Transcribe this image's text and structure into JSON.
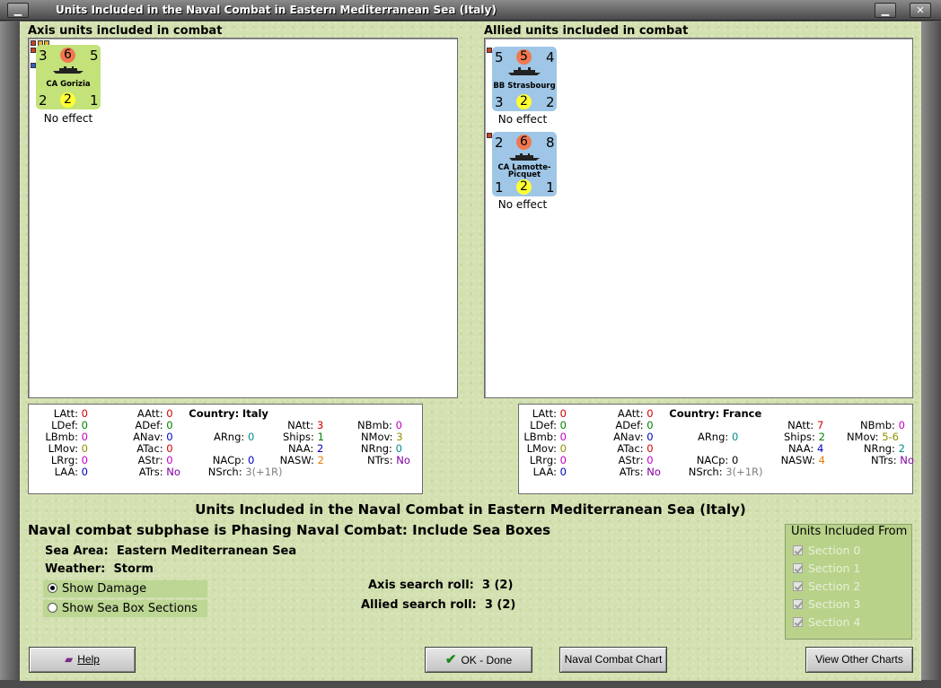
{
  "window": {
    "title": "Units Included in the Naval Combat in Eastern Mediterranean Sea (Italy)",
    "menu_icon": "minimize-icon",
    "close_icon": "close-icon"
  },
  "axis": {
    "header": "Axis units included in combat",
    "units": [
      {
        "name": "CA Gorizia",
        "top_left": "3",
        "top_mid": "6",
        "top_right": "5",
        "bot_left": "2",
        "bot_mid": "2",
        "bot_right": "1",
        "status": "No effect",
        "color": "#c3e27a"
      }
    ],
    "stats": {
      "country_label": "Country:",
      "country": "Italy",
      "LAtt": "0",
      "LDef": "0",
      "LBmb": "0",
      "LMov": "0",
      "LRrg": "0",
      "LAA": "0",
      "AAtt": "0",
      "ADef": "0",
      "ANav": "0",
      "ATac": "0",
      "AStr": "0",
      "ATrs": "No",
      "ARng": "0",
      "NACp": "0",
      "NSrch": "3(+1R)",
      "NAtt": "3",
      "Ships": "1",
      "NAA": "2",
      "NASW": "2",
      "NBmb": "0",
      "NMov": "3",
      "NRng": "0",
      "NTrs": "No"
    }
  },
  "allied": {
    "header": "Allied units included in combat",
    "units": [
      {
        "name": "BB Strasbourg",
        "top_left": "5",
        "top_mid": "5",
        "top_right": "4",
        "bot_left": "3",
        "bot_mid": "2",
        "bot_right": "2",
        "status": "No effect",
        "color": "#9fc6e6"
      },
      {
        "name": "CA Lamotte-Picquet",
        "name1": "CA Lamotte-",
        "name2": "Picquet",
        "top_left": "2",
        "top_mid": "6",
        "top_right": "8",
        "bot_left": "1",
        "bot_mid": "2",
        "bot_right": "1",
        "status": "No effect",
        "color": "#9fc6e6"
      }
    ],
    "stats": {
      "country_label": "Country:",
      "country": "France",
      "LAtt": "0",
      "LDef": "0",
      "LBmb": "0",
      "LMov": "0",
      "LRrg": "0",
      "LAA": "0",
      "AAtt": "0",
      "ADef": "0",
      "ANav": "0",
      "ATac": "0",
      "AStr": "0",
      "ATrs": "No",
      "ARng": "0",
      "NACp": "0",
      "NSrch": "3(+1R)",
      "NAtt": "7",
      "Ships": "2",
      "NAA": "4",
      "NASW": "4",
      "NBmb": "0",
      "NMov": "5-6",
      "NRng": "2",
      "NTrs": "No"
    }
  },
  "main_title": "Units Included in the Naval Combat in Eastern Mediterranean Sea (Italy)",
  "subphase": "Naval combat subphase is Phasing Naval Combat: Include Sea Boxes",
  "sea_area": {
    "label": "Sea Area:",
    "value": "Eastern Mediterranean Sea"
  },
  "weather": {
    "label": "Weather:",
    "value": "Storm"
  },
  "options": {
    "show_damage": "Show Damage",
    "show_sections": "Show Sea Box Sections",
    "selected": "show_damage"
  },
  "rolls": {
    "axis_label": "Axis search roll:",
    "axis_value": "3 (2)",
    "allied_label": "Allied search roll:",
    "allied_value": "3 (2)"
  },
  "units_from": {
    "legend": "Units Included From",
    "sections": [
      "Section 0",
      "Section 1",
      "Section 2",
      "Section 3",
      "Section 4"
    ]
  },
  "buttons": {
    "help": "Help",
    "ok": "OK - Done",
    "naval_chart": "Naval Combat Chart",
    "other_charts": "View Other Charts"
  },
  "colors": {
    "background": "#d3e0b0",
    "axis_counter": "#c3e27a",
    "allied_counter": "#9fc6e6",
    "circle_red": "#f07850",
    "circle_yellow": "#ffff33"
  }
}
